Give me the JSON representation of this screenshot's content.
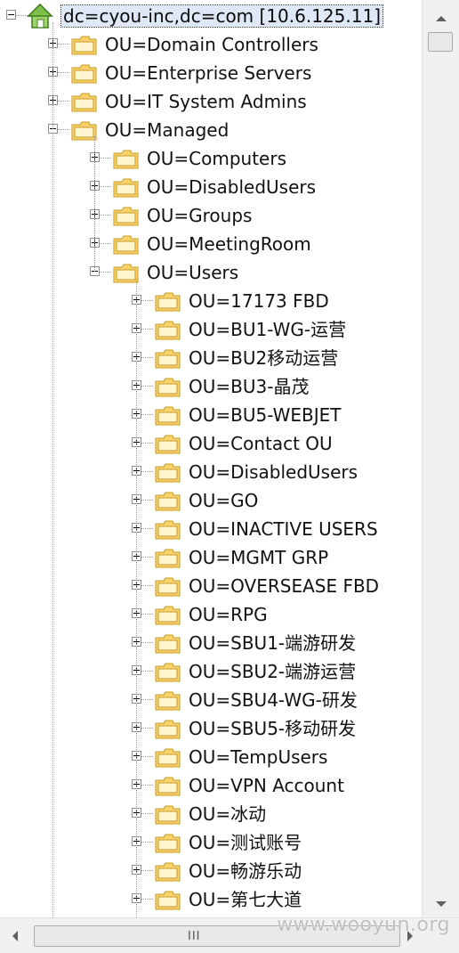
{
  "root": {
    "label": "dc=cyou-inc,dc=com [10.6.125.11]",
    "icon": "house-icon",
    "expanded": true
  },
  "top_ous": [
    {
      "label": "OU=Domain Controllers",
      "expanded": false
    },
    {
      "label": "OU=Enterprise Servers",
      "expanded": false
    },
    {
      "label": "OU=IT System Admins",
      "expanded": false
    },
    {
      "label": "OU=Managed",
      "expanded": true
    }
  ],
  "managed_children": [
    {
      "label": "OU=Computers",
      "expanded": false
    },
    {
      "label": "OU=DisabledUsers",
      "expanded": false
    },
    {
      "label": "OU=Groups",
      "expanded": false
    },
    {
      "label": "OU=MeetingRoom",
      "expanded": false
    },
    {
      "label": "OU=Users",
      "expanded": true
    }
  ],
  "users_children": [
    {
      "label": "OU=17173 FBD"
    },
    {
      "label": "OU=BU1-WG-运营"
    },
    {
      "label": "OU=BU2移动运营"
    },
    {
      "label": "OU=BU3-晶茂"
    },
    {
      "label": "OU=BU5-WEBJET"
    },
    {
      "label": "OU=Contact OU"
    },
    {
      "label": "OU=DisabledUsers"
    },
    {
      "label": "OU=GO"
    },
    {
      "label": "OU=INACTIVE USERS"
    },
    {
      "label": "OU=MGMT GRP"
    },
    {
      "label": "OU=OVERSEASE FBD"
    },
    {
      "label": "OU=RPG"
    },
    {
      "label": "OU=SBU1-端游研发"
    },
    {
      "label": "OU=SBU2-端游运营"
    },
    {
      "label": "OU=SBU4-WG-研发"
    },
    {
      "label": "OU=SBU5-移动研发"
    },
    {
      "label": "OU=TempUsers"
    },
    {
      "label": "OU=VPN Account"
    },
    {
      "label": "OU=冰动"
    },
    {
      "label": "OU=测试账号"
    },
    {
      "label": "OU=畅游乐动"
    },
    {
      "label": "OU=第七大道"
    }
  ],
  "icons": {
    "folder": "folder-icon",
    "expand": "plus-box-icon",
    "collapse": "minus-box-icon"
  },
  "colors": {
    "folder_fill": "#f8d468",
    "folder_edge": "#c8972a",
    "selection": "#dfe8f6"
  },
  "hscroll": {
    "grip": "III"
  },
  "watermark": "www.wooyun.org"
}
